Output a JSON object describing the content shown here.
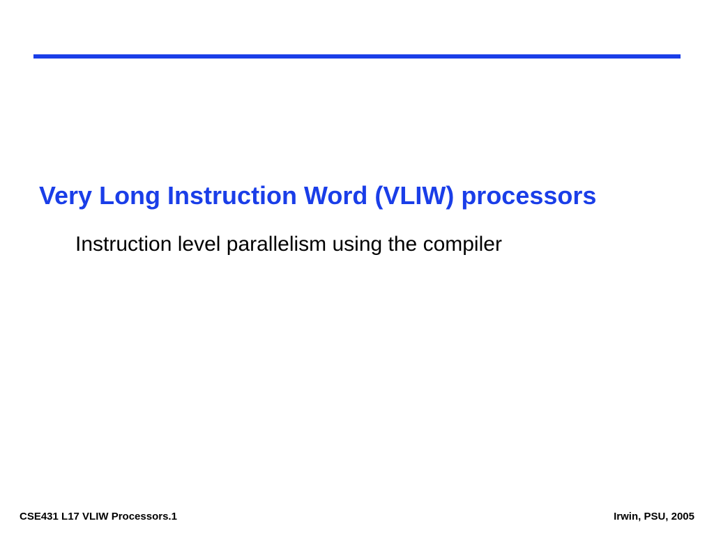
{
  "slide": {
    "title": "Very Long Instruction Word (VLIW) processors",
    "body": "Instruction level parallelism using the compiler"
  },
  "footer": {
    "left": "CSE431  L17 VLIW Processors.1",
    "right": "Irwin, PSU, 2005"
  },
  "colors": {
    "accent": "#1a3ee8"
  }
}
